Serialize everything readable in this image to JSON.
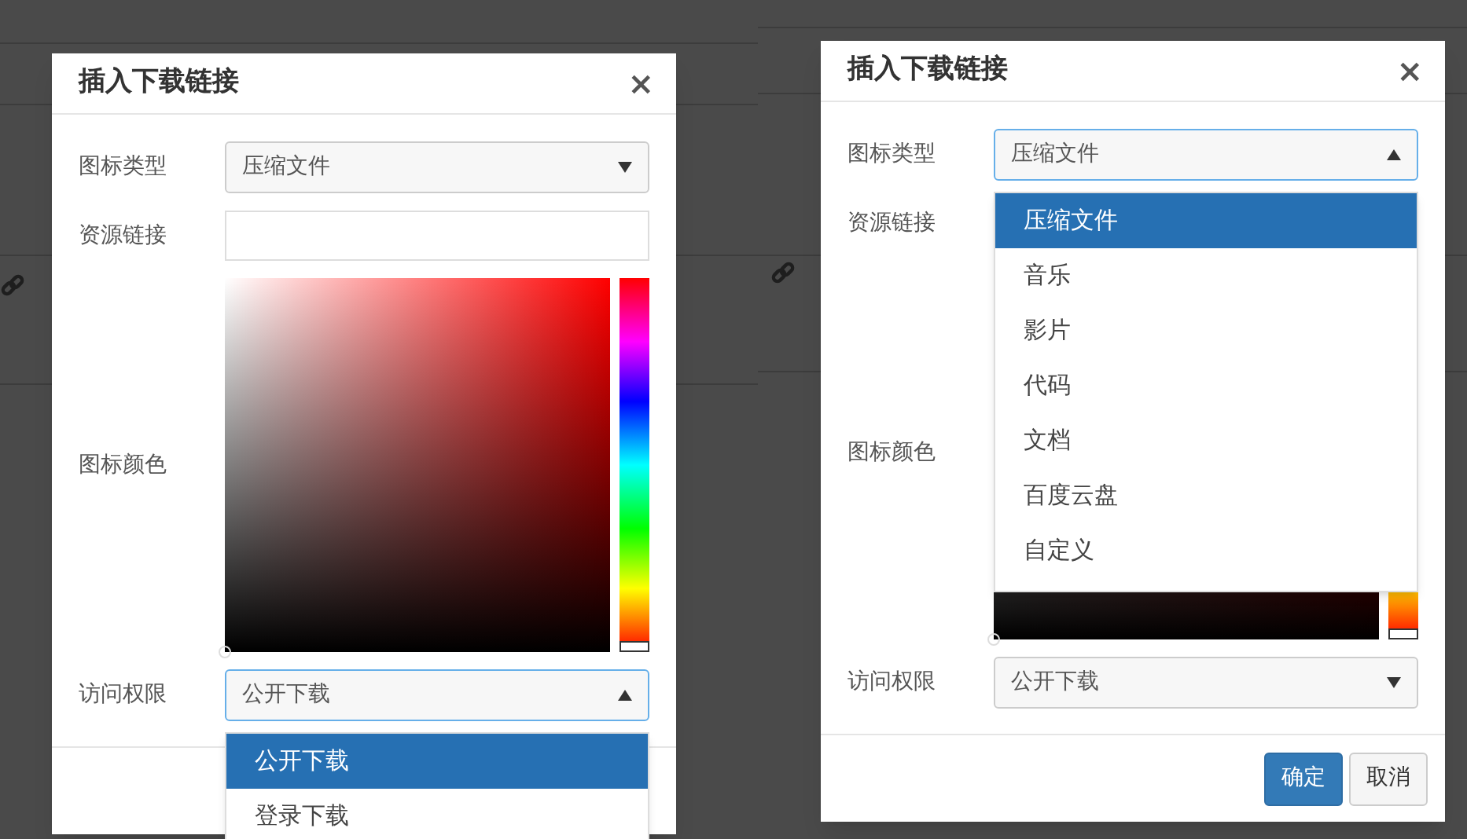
{
  "panels": [
    {
      "title": "插入下载链接",
      "close": "×",
      "fields": [
        {
          "kind": "select",
          "label": "图标类型",
          "value": "压缩文件",
          "open": false
        },
        {
          "kind": "text",
          "label": "资源链接"
        },
        {
          "kind": "color",
          "label": "图标颜色",
          "level": 0
        },
        {
          "kind": "select",
          "label": "访问权限",
          "value": "公开下载",
          "open": true,
          "options": [
            {
              "label": "公开下载",
              "selected": true
            },
            {
              "label": "登录下载",
              "selected": false
            }
          ]
        }
      ]
    },
    {
      "title": "插入下载链接",
      "close": "×",
      "fields": [
        {
          "kind": "select",
          "label": "图标类型",
          "value": "压缩文件",
          "open": true,
          "options": [
            {
              "label": "压缩文件",
              "selected": true
            },
            {
              "label": "音乐",
              "selected": false
            },
            {
              "label": "影片",
              "selected": false
            },
            {
              "label": "代码",
              "selected": false
            },
            {
              "label": "文档",
              "selected": false
            },
            {
              "label": "百度云盘",
              "selected": false
            },
            {
              "label": "自定义",
              "selected": false
            }
          ]
        },
        {
          "kind": "text",
          "label": "资源链接"
        },
        {
          "kind": "color",
          "label": "图标颜色",
          "level": 0
        },
        {
          "kind": "select",
          "label": "访问权限",
          "value": "公开下载",
          "open": false
        }
      ],
      "buttons": [
        {
          "label": "确定",
          "kind": "primary"
        },
        {
          "label": "取消",
          "kind": "default"
        }
      ]
    }
  ]
}
